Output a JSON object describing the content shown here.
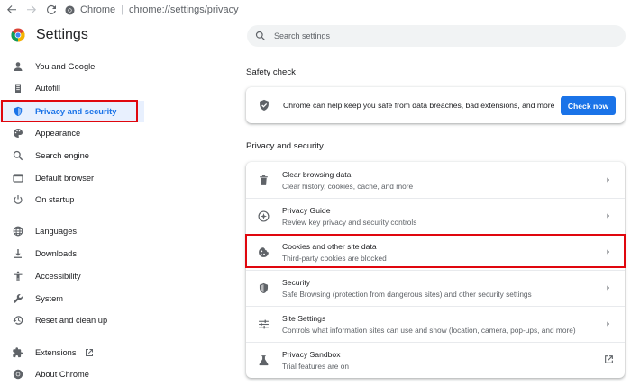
{
  "browser": {
    "chip_label": "Chrome",
    "url": "chrome://settings/privacy"
  },
  "sidebar": {
    "title": "Settings",
    "items": [
      {
        "label": "You and Google",
        "icon": "person-icon"
      },
      {
        "label": "Autofill",
        "icon": "clipboard-icon"
      },
      {
        "label": "Privacy and security",
        "icon": "shield-icon",
        "active": true
      },
      {
        "label": "Appearance",
        "icon": "palette-icon"
      },
      {
        "label": "Search engine",
        "icon": "search-icon"
      },
      {
        "label": "Default browser",
        "icon": "browser-window-icon"
      },
      {
        "label": "On startup",
        "icon": "power-icon"
      },
      {
        "label": "Languages",
        "icon": "globe-icon"
      },
      {
        "label": "Downloads",
        "icon": "download-icon"
      },
      {
        "label": "Accessibility",
        "icon": "accessibility-icon"
      },
      {
        "label": "System",
        "icon": "wrench-icon"
      },
      {
        "label": "Reset and clean up",
        "icon": "history-icon"
      },
      {
        "label": "Extensions",
        "icon": "puzzle-icon"
      },
      {
        "label": "About Chrome",
        "icon": "chrome-logo-icon"
      }
    ]
  },
  "search": {
    "placeholder": "Search settings"
  },
  "safety_check": {
    "heading": "Safety check",
    "message": "Chrome can help keep you safe from data breaches, bad extensions, and more",
    "button_label": "Check now"
  },
  "privacy": {
    "heading": "Privacy and security",
    "rows": [
      {
        "title": "Clear browsing data",
        "subtitle": "Clear history, cookies, cache, and more",
        "icon": "trash-icon"
      },
      {
        "title": "Privacy Guide",
        "subtitle": "Review key privacy and security controls",
        "icon": "compass-icon"
      },
      {
        "title": "Cookies and other site data",
        "subtitle": "Third-party cookies are blocked",
        "icon": "cookie-icon"
      },
      {
        "title": "Security",
        "subtitle": "Safe Browsing (protection from dangerous sites) and other security settings",
        "icon": "shield-icon"
      },
      {
        "title": "Site Settings",
        "subtitle": "Controls what information sites can use and show (location, camera, pop-ups, and more)",
        "icon": "sliders-icon"
      },
      {
        "title": "Privacy Sandbox",
        "subtitle": "Trial features are on",
        "icon": "flask-icon"
      }
    ]
  },
  "colors": {
    "accent": "#1a73e8",
    "highlight_border": "#e0070e",
    "active_bg": "#e8f0fe"
  }
}
